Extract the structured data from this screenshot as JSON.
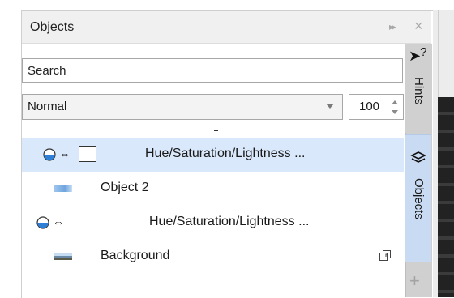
{
  "panel": {
    "title": "Objects",
    "expand_glyph": "▸▸",
    "close_glyph": "×"
  },
  "search": {
    "placeholder": "Search",
    "value": ""
  },
  "blend": {
    "value": "Normal"
  },
  "opacity": {
    "value": "100"
  },
  "side_tabs": {
    "hints_label": "Hints",
    "objects_label": "Objects",
    "add_glyph": "+",
    "help_glyph": "?"
  },
  "layers": [
    {
      "name": "Hue/Saturation/Lightness ...",
      "kind": "adjustment",
      "selected": true,
      "has_mask": true
    },
    {
      "name": "Object 2",
      "kind": "object",
      "selected": false
    },
    {
      "name": "Hue/Saturation/Lightness ...",
      "kind": "adjustment",
      "selected": false,
      "has_mask": false
    },
    {
      "name": "Background",
      "kind": "background",
      "selected": false
    }
  ],
  "colors": {
    "selected_row": "#d9e8fb",
    "visibility_blue": "#2f7fd6",
    "active_tab": "#c9daf3"
  },
  "icons": {
    "visibility": "visibility-icon",
    "link": "link-icon",
    "layers": "layers-icon",
    "cursor_help": "cursor-help-icon",
    "background_action": "convert-to-object-icon"
  }
}
